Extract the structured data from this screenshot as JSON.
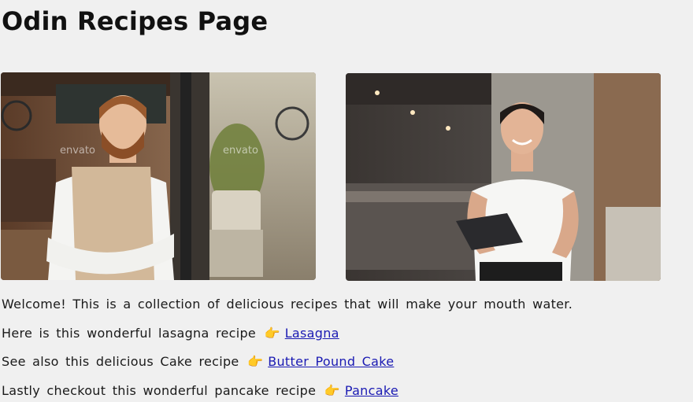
{
  "page": {
    "title": "Odin Recipes Page",
    "images": [
      {
        "name": "bearded-man-apron-photo",
        "watermark": "envato"
      },
      {
        "name": "woman-tablet-photo",
        "watermark": ""
      }
    ],
    "intro": "Welcome! This is a collection of delicious recipes that will make your mouth water.",
    "recipes": [
      {
        "text": "Here is this wonderful lasagna recipe",
        "emoji": "👉",
        "link_label": "Lasagna"
      },
      {
        "text": "See also this delicious Cake recipe",
        "emoji": "👉",
        "link_label": "Butter Pound Cake"
      },
      {
        "text": "Lastly checkout this wonderful pancake recipe",
        "emoji": "👉",
        "link_label": "Pancake"
      }
    ]
  },
  "colors": {
    "background": "#f0f0f0",
    "link": "#1a1ab3",
    "heading": "#111111"
  }
}
